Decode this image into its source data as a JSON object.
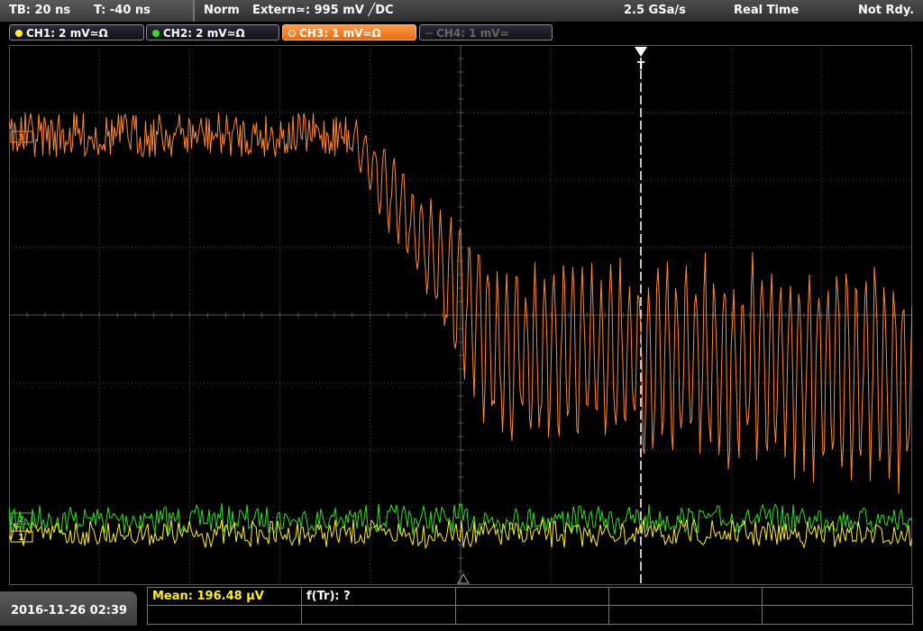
{
  "header": {
    "timebase": "TB: 20 ns",
    "trigger_time": "T: -40 ns",
    "mode": "Norm",
    "trigger_source": "Extern≃: 995 mV ╱DC",
    "sample_rate": "2.5 GSa/s",
    "acq_mode": "Real Time",
    "status": "Not Rdy."
  },
  "channels": [
    {
      "label": "CH1: 2 mV≃Ω",
      "color": "#ffee22",
      "state": "on"
    },
    {
      "label": "CH2: 2 mV≃Ω",
      "color": "#33dd22",
      "state": "on"
    },
    {
      "label": "CH3: 1 mV≃Ω",
      "color": "#ff8a30",
      "state": "active"
    },
    {
      "label": "CH4: 1 mV≃",
      "color": "#666666",
      "state": "off"
    }
  ],
  "markers": {
    "trigger_top": "T",
    "ch3_ref": "3",
    "ch2_ref": "2",
    "ch1_ref": "1"
  },
  "footer": {
    "datetime": "2016-11-26 02:39",
    "mean": "Mean: 196.48 µV",
    "ftr": "f(Tr): ?"
  },
  "colors": {
    "ch1": "#ffee22",
    "ch2": "#33dd22",
    "ch3": "#ff8a30",
    "grid": "#555555"
  }
}
